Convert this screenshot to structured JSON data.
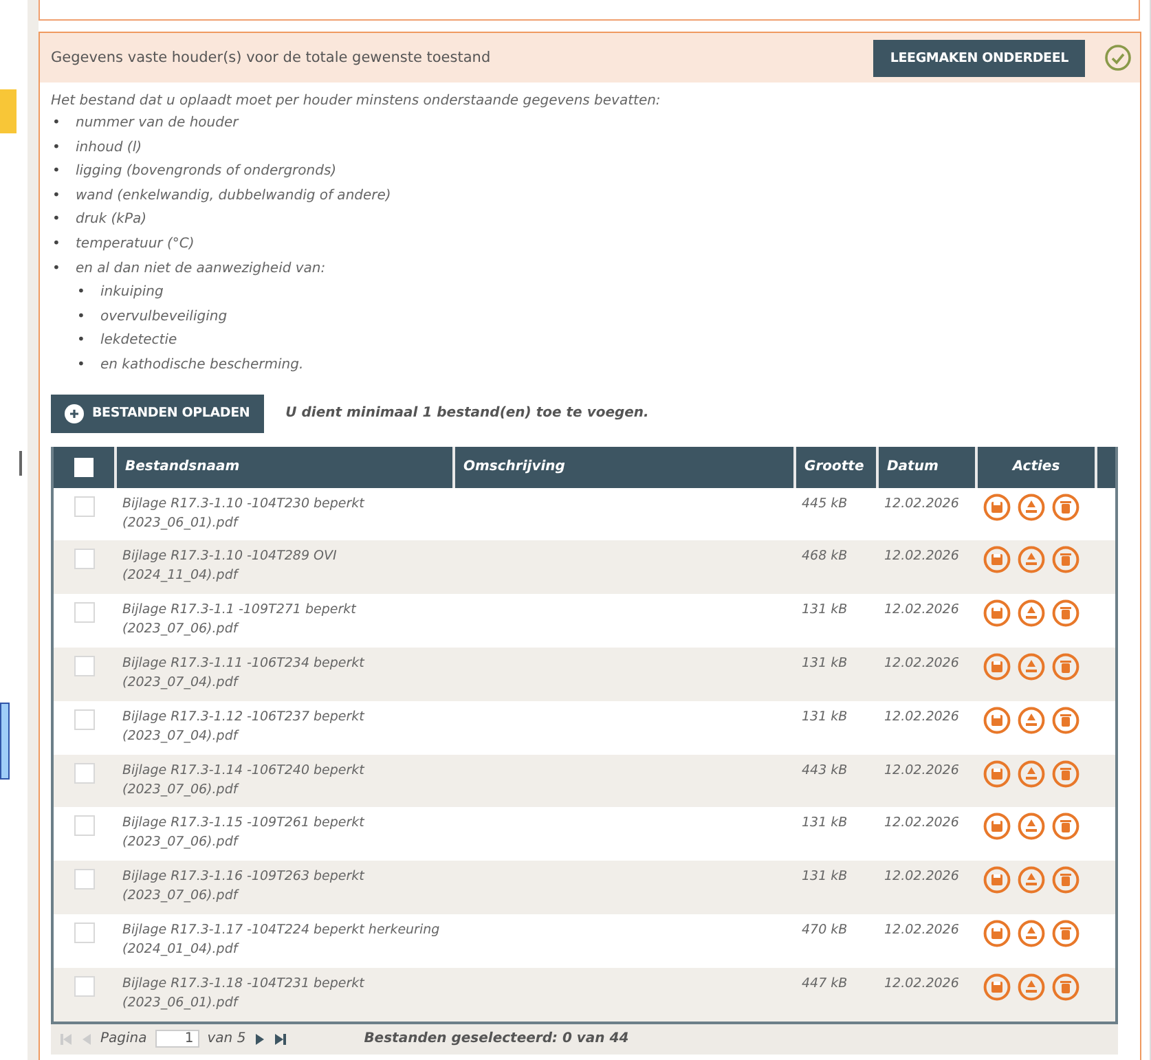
{
  "section": {
    "title": "Gegevens vaste houder(s) voor de totale gewenste toestand",
    "clear_button": "LEEGMAKEN ONDERDEEL",
    "complete": true,
    "intro": "Het bestand dat u oplaadt moet per houder minstens onderstaande gegevens bevatten:",
    "requirements": [
      {
        "bullet": "•",
        "text": "nummer van de houder"
      },
      {
        "bullet": "•",
        "text": "inhoud (l)"
      },
      {
        "bullet": "•",
        "text": "ligging (bovengronds of ondergronds)"
      },
      {
        "bullet": "•",
        "text": "wand (enkelwandig, dubbelwandig of andere)"
      },
      {
        "bullet": "•",
        "text": "druk (kPa)"
      },
      {
        "bullet": "•",
        "text": "temperatuur (°C)"
      },
      {
        "bullet": "•",
        "text": "en al dan niet de aanwezigheid van:",
        "children": [
          {
            "bullet": "•",
            "text": "inkuiping"
          },
          {
            "bullet": "•",
            "text": "overvulbeveiliging"
          },
          {
            "bullet": "•",
            "text": "lekdetectie"
          },
          {
            "bullet": "•",
            "text": "en kathodische bescherming."
          }
        ]
      }
    ],
    "upload_button": "BESTANDEN OPLADEN",
    "upload_hint": "U dient minimaal 1 bestand(en) toe te voegen."
  },
  "table": {
    "select_all_checked": false,
    "columns": [
      "Bestandsnaam",
      "Omschrijving",
      "Grootte",
      "Datum",
      "Acties"
    ],
    "rows": [
      {
        "checked": false,
        "name": "Bijlage R17.3-1.10 -104T230 beperkt (2023_06_01).pdf",
        "size": "445 kB",
        "date": "12.02.2026"
      },
      {
        "checked": false,
        "name": "Bijlage R17.3-1.10 -104T289 OVI (2024_11_04).pdf",
        "size": "468 kB",
        "date": "12.02.2026"
      },
      {
        "checked": false,
        "name": "Bijlage R17.3-1.1 -109T271 beperkt (2023_07_06).pdf",
        "size": "131 kB",
        "date": "12.02.2026"
      },
      {
        "checked": false,
        "name": "Bijlage R17.3-1.11 -106T234 beperkt (2023_07_04).pdf",
        "size": "131 kB",
        "date": "12.02.2026"
      },
      {
        "checked": false,
        "name": "Bijlage R17.3-1.12 -106T237 beperkt (2023_07_04).pdf",
        "size": "131 kB",
        "date": "12.02.2026"
      },
      {
        "checked": false,
        "name": "Bijlage R17.3-1.14 -106T240 beperkt (2023_07_06).pdf",
        "size": "443 kB",
        "date": "12.02.2026"
      },
      {
        "checked": false,
        "name": "Bijlage R17.3-1.15 -109T261 beperkt (2023_07_06).pdf",
        "size": "131 kB",
        "date": "12.02.2026"
      },
      {
        "checked": false,
        "name": "Bijlage R17.3-1.16 -109T263 beperkt (2023_07_06).pdf",
        "size": "131 kB",
        "date": "12.02.2026"
      },
      {
        "checked": false,
        "name": "Bijlage R17.3-1.17 -104T224 beperkt herkeuring (2024_01_04).pdf",
        "size": "470 kB",
        "date": "12.02.2026"
      },
      {
        "checked": false,
        "name": "Bijlage R17.3-1.18 -104T231 beperkt (2023_06_01).pdf",
        "size": "447 kB",
        "date": "12.02.2026"
      }
    ]
  },
  "pager": {
    "label": "Pagina",
    "page": "1",
    "of": "van 5",
    "selected_info": "Bestanden geselecteerd: 0 van 44"
  }
}
